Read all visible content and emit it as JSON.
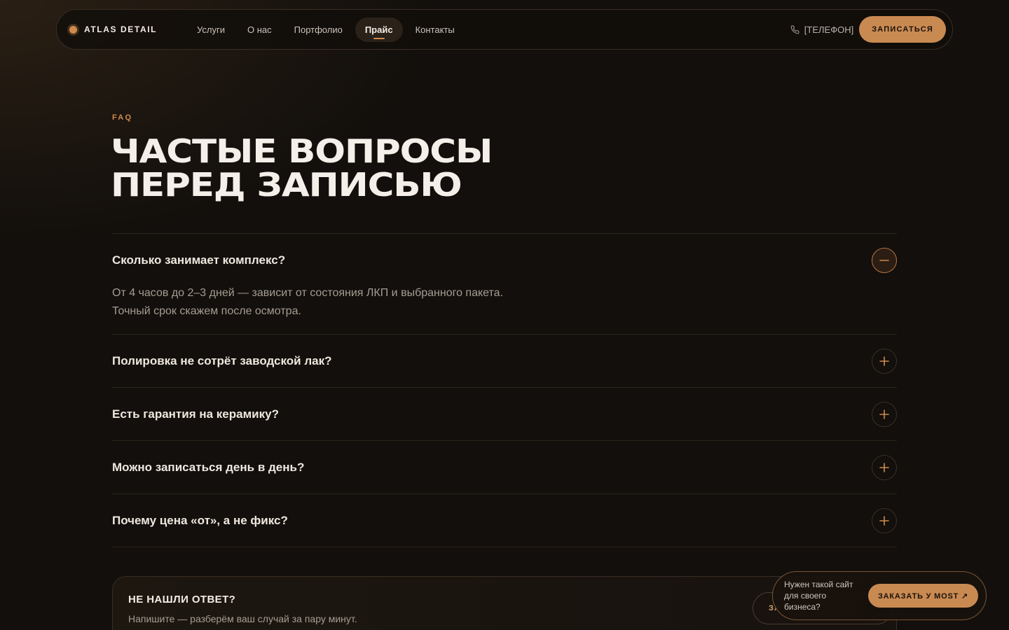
{
  "nav": {
    "brand": "ATLAS DETAIL",
    "items": [
      {
        "label": "Услуги"
      },
      {
        "label": "О нас"
      },
      {
        "label": "Портфолио"
      },
      {
        "label": "Прайс",
        "active": true
      },
      {
        "label": "Контакты"
      }
    ],
    "phone": "[ТЕЛЕФОН]",
    "cta": "ЗАПИСАТЬСЯ"
  },
  "faq": {
    "eyebrow": "FAQ",
    "title_line1": "Частые вопросы",
    "title_line2": "перед записью",
    "items": [
      {
        "question": "Сколько занимает комплекс?",
        "open": true,
        "answer_line1": "От 4 часов до 2–3 дней — зависит от состояния ЛКП и выбранного пакета.",
        "answer_line2": "Точный срок скажем после осмотра."
      },
      {
        "question": "Полировка не сотрёт заводской лак?",
        "open": false
      },
      {
        "question": "Есть гарантия на керамику?",
        "open": false
      },
      {
        "question": "Можно записаться день в день?",
        "open": false
      },
      {
        "question": "Почему цена «от», а не фикс?",
        "open": false
      }
    ]
  },
  "help": {
    "title": "НЕ НАШЛИ ОТВЕТ?",
    "subtitle": "Напишите — разберём ваш случай за пару минут.",
    "button": "ЗА"
  },
  "promo": {
    "text_line1": "Нужен такой сайт",
    "text_line2": "для своего",
    "text_line3": "бизнеса?",
    "button": "ЗАКАЗАТЬ У MOST ↗"
  },
  "colors": {
    "accent": "#c98a52",
    "background": "#120f0c"
  }
}
